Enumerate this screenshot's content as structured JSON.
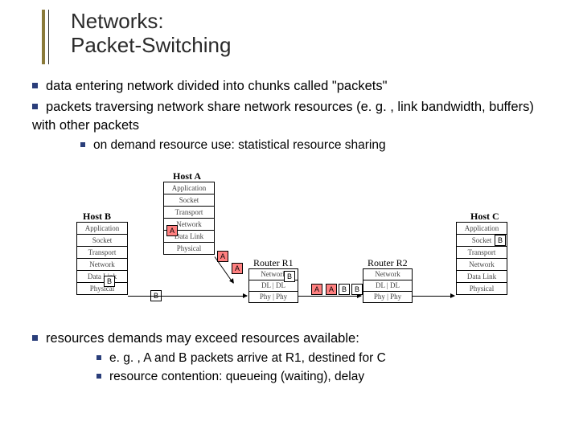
{
  "title": {
    "line1": "Networks:",
    "line2": "Packet-Switching"
  },
  "bullets": {
    "a1": "data entering network divided into chunks called \"packets\"",
    "a2": "packets traversing network share network resources (e. g. , link bandwidth, buffers) with other packets",
    "a2_1": "on demand resource use: statistical resource sharing",
    "c1": "resources demands may exceed resources available:",
    "c1_1": "e. g. , A and B packets arrive at R1, destined for C",
    "c1_2": "resource contention: queueing (waiting), delay"
  },
  "diagram": {
    "hostA": "Host A",
    "hostB": "Host B",
    "hostC": "Host C",
    "r1": "Router R1",
    "r2": "Router R2",
    "layersFull": [
      "Application",
      "Socket",
      "Transport",
      "Network",
      "Data Link",
      "Physical"
    ],
    "layersR": [
      "Network",
      "DL | DL",
      "Phy | Phy"
    ],
    "pkt": {
      "A": "A",
      "B": "B"
    }
  }
}
